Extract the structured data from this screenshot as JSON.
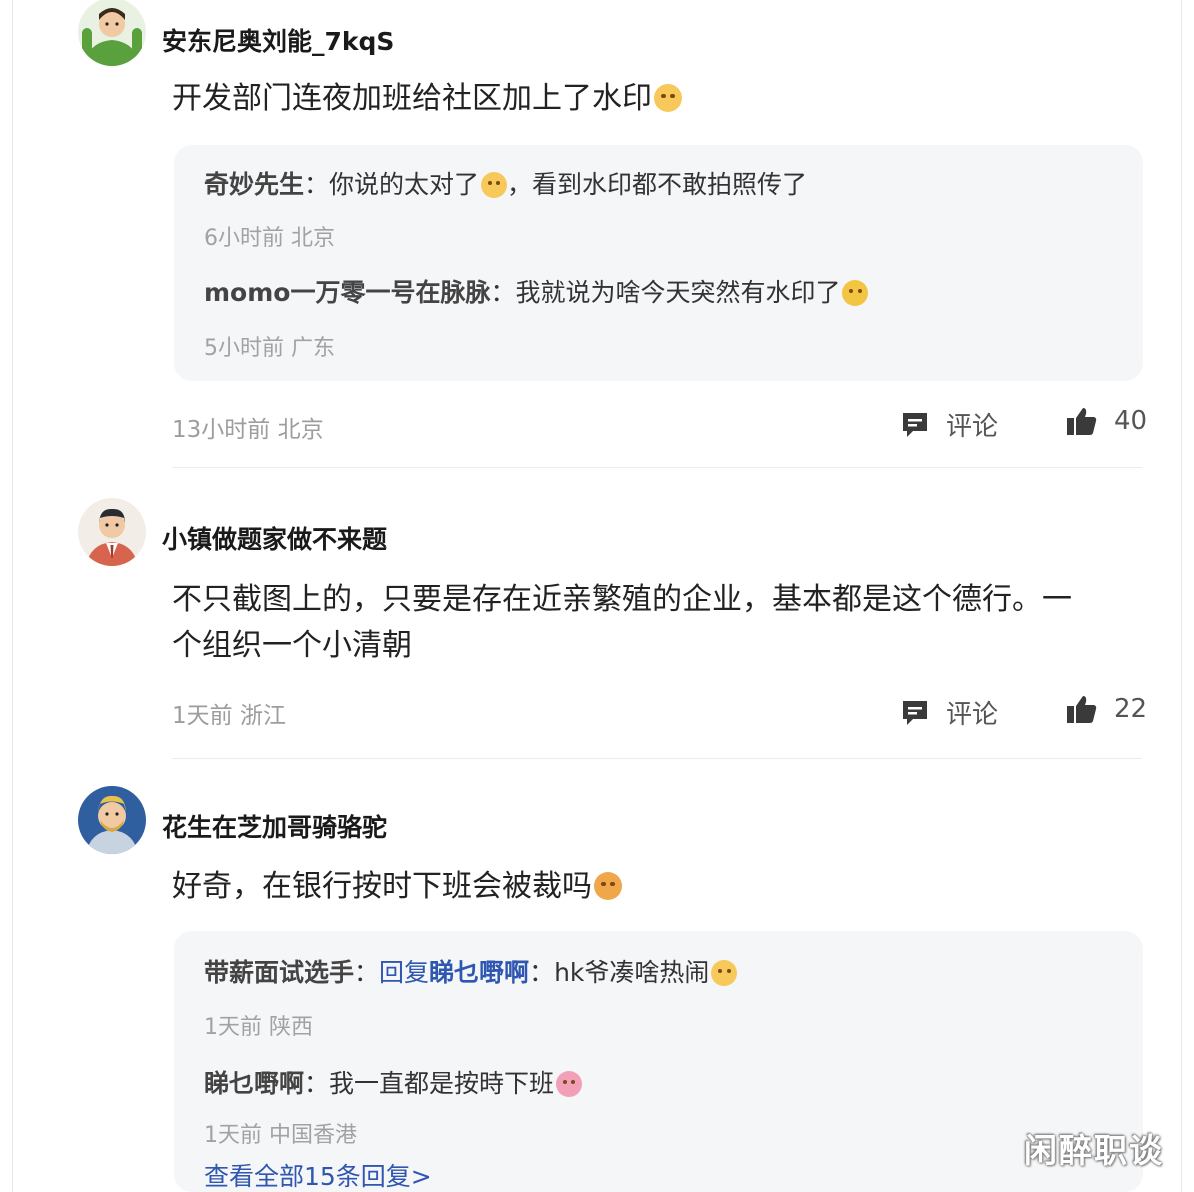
{
  "comments": [
    {
      "username": "安东尼奥刘能_7kqS",
      "text": "开发部门连夜加班给社区加上了水印",
      "emoji": "smile-emoji",
      "replies": [
        {
          "name": "奇妙先生",
          "text_a": "你说的太对了",
          "text_b": "，看到水印都不敢拍照传了",
          "meta": "6小时前 北京"
        },
        {
          "name": "momo一万零一号在脉脉",
          "text_a": "我就说为啥今天突然有水印了",
          "meta": "5小时前 广东"
        }
      ],
      "meta": "13小时前 北京",
      "comment_label": "评论",
      "likes": "40"
    },
    {
      "username": "小镇做题家做不来题",
      "text_line1": "不只截图上的，只要是存在近亲繁殖的企业，基本都是这个德行。一",
      "text_line2": "个组织一个小清朝",
      "meta": "1天前 浙江",
      "comment_label": "评论",
      "likes": "22"
    },
    {
      "username": "花生在芝加哥骑骆驼",
      "text": "好奇，在银行按时下班会被裁吗",
      "replies": [
        {
          "name": "带薪面试选手",
          "reply_prefix": "回复",
          "reply_to": "睇乜嘢啊",
          "text_a": "hk爷凑啥热闹",
          "meta": "1天前 陕西"
        },
        {
          "name": "睇乜嘢啊",
          "text_a": "我一直都是按時下班",
          "meta": "1天前 中国香港"
        }
      ],
      "view_all": "查看全部15条回复>"
    }
  ],
  "colon": "：",
  "watermark": "闲醉职谈",
  "colors": {
    "link": "#2f56b0",
    "reply_bg": "#f5f6f8",
    "meta": "#9d9d9d"
  }
}
